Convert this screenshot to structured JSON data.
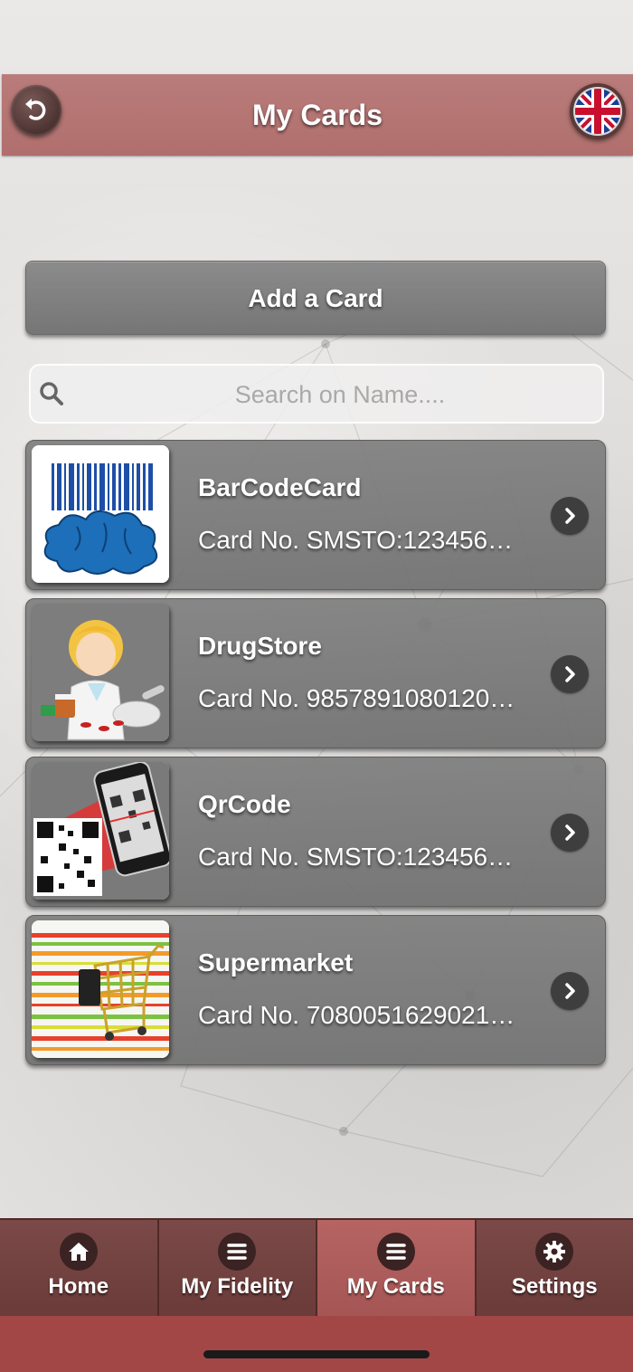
{
  "header": {
    "title": "My Cards",
    "back_icon": "undo-arrow-icon",
    "language_icon": "uk-flag-icon"
  },
  "add_card": {
    "label": "Add a Card"
  },
  "search": {
    "placeholder": "Search on Name....",
    "value": "",
    "icon": "search-icon"
  },
  "cards": [
    {
      "name": "BarCodeCard",
      "number": "Card No. SMSTO:123456…",
      "image": "barcode-puzzle-image"
    },
    {
      "name": "DrugStore",
      "number": "Card No. 9857891080120…",
      "image": "pharmacist-image"
    },
    {
      "name": "QrCode",
      "number": "Card No. SMSTO:123456…",
      "image": "qr-phone-scan-image"
    },
    {
      "name": "Supermarket",
      "number": "Card No. 7080051629021…",
      "image": "shopping-cart-image"
    }
  ],
  "tabs": [
    {
      "label": "Home",
      "icon": "home-icon",
      "active": false
    },
    {
      "label": "My Fidelity",
      "icon": "menu-icon",
      "active": false
    },
    {
      "label": "My Cards",
      "icon": "menu-icon",
      "active": true
    },
    {
      "label": "Settings",
      "icon": "gear-icon",
      "active": false
    }
  ],
  "colors": {
    "header": "#b06f6d",
    "tab_active": "#a55654",
    "tab_inactive": "#6a3b39",
    "card_background": "#777777"
  }
}
